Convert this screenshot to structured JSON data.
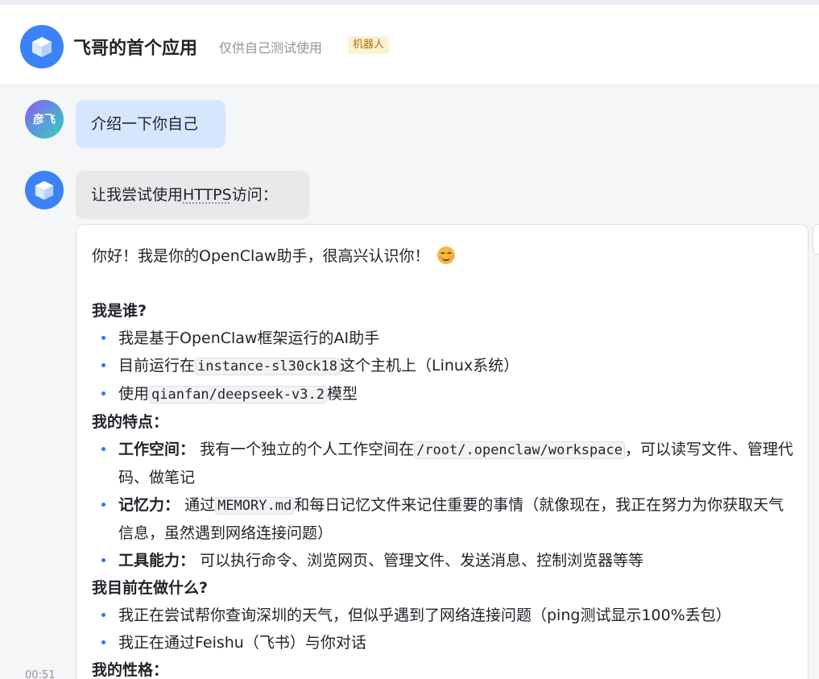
{
  "header": {
    "app_name": "飞哥的首个应用",
    "subtitle": "仅供自己测试使用",
    "badge": "机器人"
  },
  "colors": {
    "accent": "#3370ff",
    "user_bubble": "#d6e6ff",
    "bot_bubble": "#e8e9eb",
    "badge_bg": "#fdf1d3"
  },
  "messages": {
    "user": {
      "avatar_text": "彦飞",
      "text": "介绍一下你自己"
    },
    "bot_short": {
      "text_before": "让我尝试使用",
      "abbr": "HTTPS",
      "text_after": "访问："
    },
    "bot_card": {
      "greeting": "你好！我是你的OpenClaw助手，很高兴认识你！",
      "emoji_icon": "smiling-face-icon",
      "sections": {
        "who": {
          "title": "我是谁?",
          "item1": "我是基于OpenClaw框架运行的AI助手",
          "item2_pre": "目前运行在",
          "item2_code": "instance-sl30ck18",
          "item2_post": "这个主机上（Linux系统）",
          "item3_pre": "使用",
          "item3_code": "qianfan/deepseek-v3.2",
          "item3_post": "模型"
        },
        "features": {
          "title": "我的特点：",
          "item1_label": "工作空间：",
          "item1_pre": "我有一个独立的个人工作空间在",
          "item1_code": "/root/.openclaw/workspace",
          "item1_post": "，可以读写文件、管理代码、做笔记",
          "item2_label": "记忆力：",
          "item2_pre": "通过",
          "item2_code": "MEMORY.md",
          "item2_post": "和每日记忆文件来记住重要的事情（就像现在，我正在努力为你获取天气信息，虽然遇到网络连接问题）",
          "item3_label": "工具能力：",
          "item3_text": "可以执行命令、浏览网页、管理文件、发送消息、控制浏览器等等"
        },
        "doing": {
          "title": "我目前在做什么?",
          "item1": "我正在尝试帮你查询深圳的天气，但似乎遇到了网络连接问题（ping测试显示100%丢包）",
          "item2": "我正在通过Feishu（飞书）与你对话"
        },
        "personality": {
          "title": "我的性格："
        }
      }
    },
    "timestamp": "00:51"
  }
}
